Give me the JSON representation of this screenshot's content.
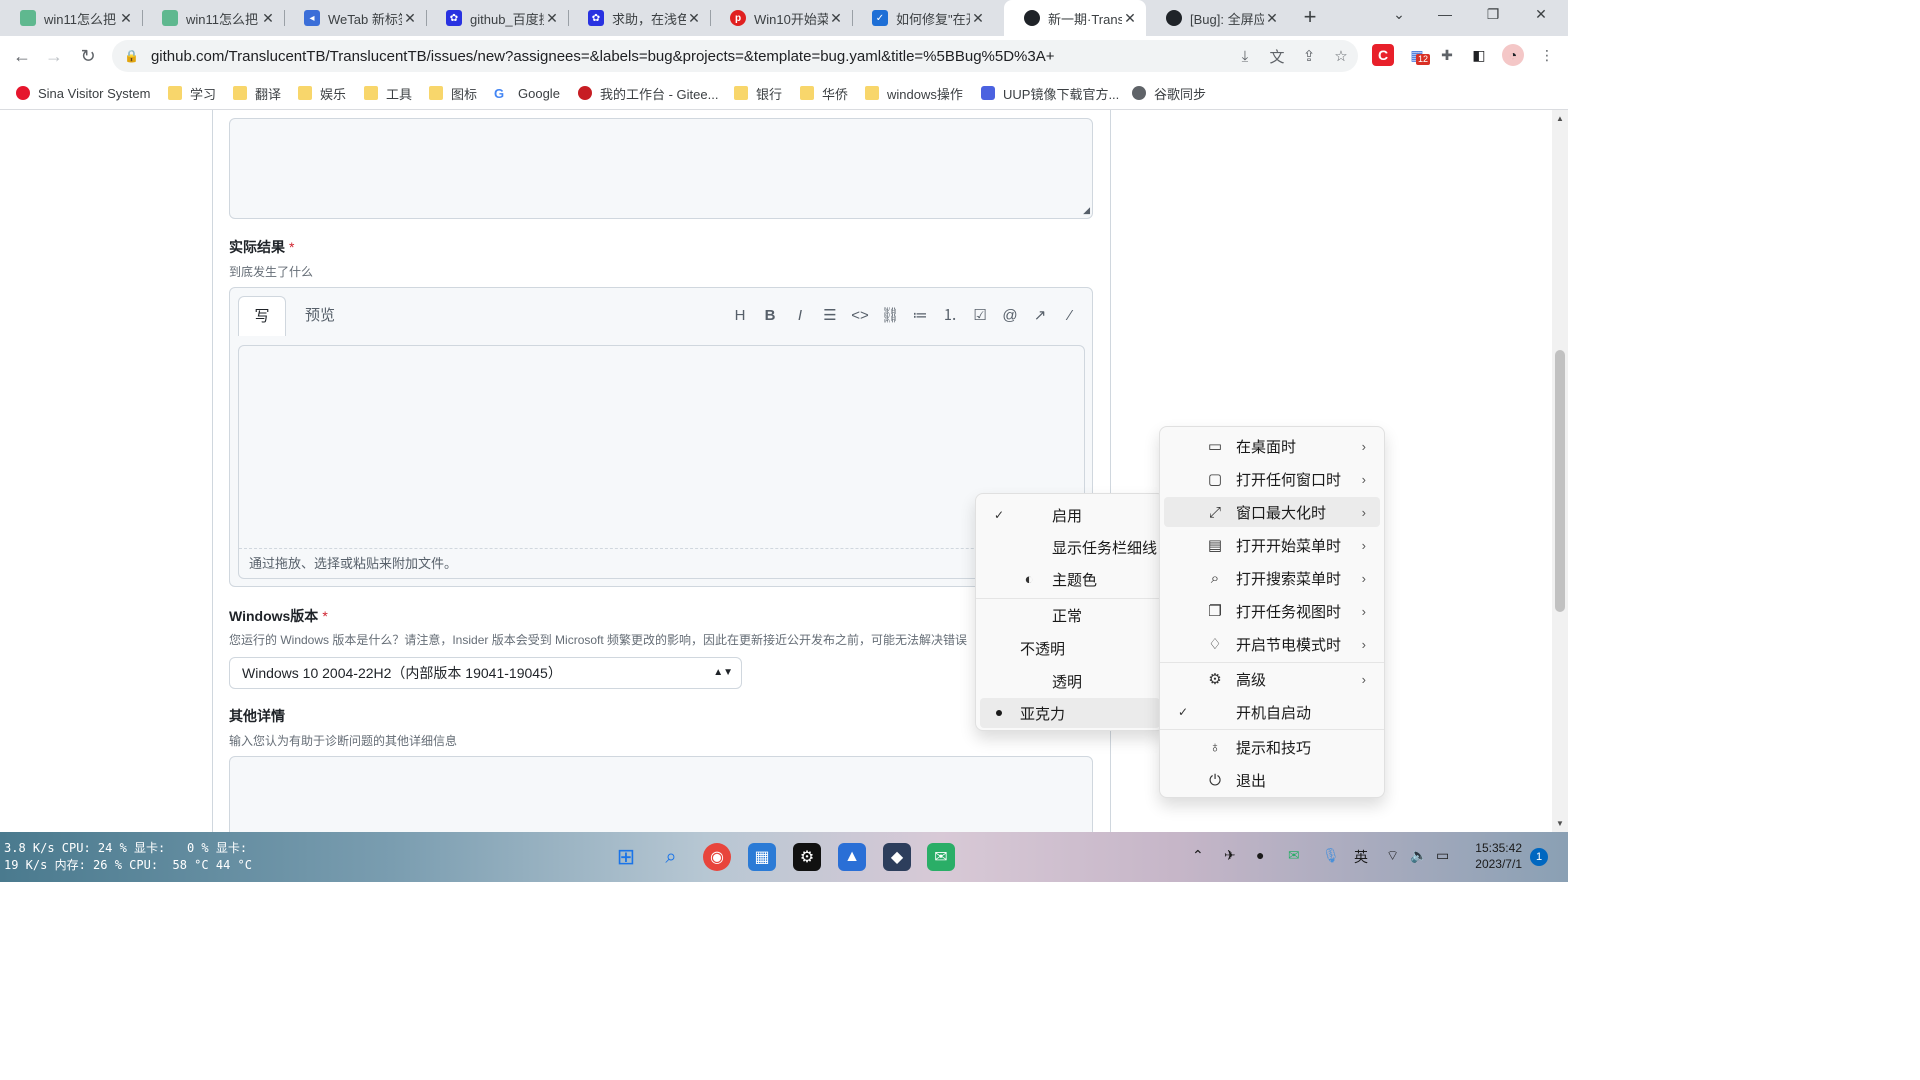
{
  "tabs": [
    {
      "title": "win11怎么把",
      "fav_color": "#5fb88f",
      "fav_text": ""
    },
    {
      "title": "win11怎么把",
      "fav_color": "#5fb88f",
      "fav_text": ""
    },
    {
      "title": "WeTab 新标签",
      "fav_color": "#3b6ed8",
      "fav_text": "◂▸"
    },
    {
      "title": "github_百度搜",
      "fav_color": "#2932e1",
      "fav_text": "🐾"
    },
    {
      "title": "求助，在浅色",
      "fav_color": "#2932e1",
      "fav_text": "🐾"
    },
    {
      "title": "Win10开始菜",
      "fav_color": "#e02020",
      "fav_text": "php"
    },
    {
      "title": "如何修复\"在开",
      "fav_color": "#1e6fd6",
      "fav_text": "🛡"
    },
    {
      "title": "新一期·Transl",
      "fav_color": "#1f2328",
      "fav_text": "●"
    },
    {
      "title": "[Bug]: 全屏应",
      "fav_color": "#1f2328",
      "fav_text": "●"
    }
  ],
  "url": "github.com/TranslucentTB/TranslucentTB/issues/new?assignees=&labels=bug&projects=&template=bug.yaml&title=%5BBug%5D%3A+",
  "ext_badge": "12",
  "bookmarks": [
    {
      "label": "Sina Visitor System",
      "icon": "weibo-icon"
    },
    {
      "label": "学习",
      "icon": "folder-icon"
    },
    {
      "label": "翻译",
      "icon": "folder-icon"
    },
    {
      "label": "娱乐",
      "icon": "folder-icon"
    },
    {
      "label": "工具",
      "icon": "folder-icon"
    },
    {
      "label": "图标",
      "icon": "folder-icon"
    },
    {
      "label": "Google",
      "icon": "google-icon"
    },
    {
      "label": "我的工作台 - Gitee...",
      "icon": "gitee-icon"
    },
    {
      "label": "银行",
      "icon": "folder-icon"
    },
    {
      "label": "华侨",
      "icon": "folder-icon"
    },
    {
      "label": "windows操作",
      "icon": "folder-icon"
    },
    {
      "label": "UUP镜像下载官方...",
      "icon": "uup-icon"
    },
    {
      "label": "谷歌同步",
      "icon": "globe-icon"
    }
  ],
  "form": {
    "actual_label": "实际结果",
    "required_mark": "*",
    "actual_hint": "到底发生了什么",
    "write_tab": "写",
    "preview_tab": "预览",
    "attach_hint": "通过拖放、选择或粘贴来附加文件。",
    "windows_label": "Windows版本",
    "windows_hint": "您运行的 Windows 版本是什么？请注意，Insider 版本会受到 Microsoft 频繁更改的影响，因此在更新接近公开发布之前，可能无法解决错误",
    "windows_value": "Windows 10 2004-22H2（内部版本 19041-19045）",
    "other_label": "其他详情",
    "other_hint": "输入您认为有助于诊断问题的其他详细信息"
  },
  "main_menu": [
    {
      "label": "在桌面时",
      "icon": "desktop-icon"
    },
    {
      "label": "打开任何窗口时",
      "icon": "window-icon"
    },
    {
      "label": "窗口最大化时",
      "icon": "maximize-icon"
    },
    {
      "label": "打开开始菜单时",
      "icon": "start-menu-icon"
    },
    {
      "label": "打开搜索菜单时",
      "icon": "search-icon"
    },
    {
      "label": "打开任务视图时",
      "icon": "task-view-icon"
    },
    {
      "label": "开启节电模式时",
      "icon": "battery-saver-icon"
    },
    {
      "label": "高级",
      "icon": "gear-icon"
    },
    {
      "label": "开机自启动",
      "icon": "check-icon"
    },
    {
      "label": "提示和技巧",
      "icon": "lightbulb-icon"
    },
    {
      "label": "退出",
      "icon": "power-icon"
    }
  ],
  "sub_menu": [
    {
      "label": "启用",
      "checked": true
    },
    {
      "label": "显示任务栏细线"
    },
    {
      "label": "主题色",
      "icon": "palette-icon"
    },
    {
      "label": "正常"
    },
    {
      "label": "不透明"
    },
    {
      "label": "透明"
    },
    {
      "label": "亚克力",
      "selected": true
    }
  ],
  "taskbar": {
    "stats_line1": "3.8 K/s CPU: 24 % 显卡:   0 % 显卡:",
    "stats_line2": "19 K/s 内存: 26 % CPU:  58 °C 44 °C",
    "ime": "英",
    "time": "15:35:42",
    "date": "2023/7/1",
    "notifications": "1"
  },
  "colors": {
    "accent": "#0969da",
    "required": "#cf222e",
    "menu_bg": "#f9f9f9"
  }
}
